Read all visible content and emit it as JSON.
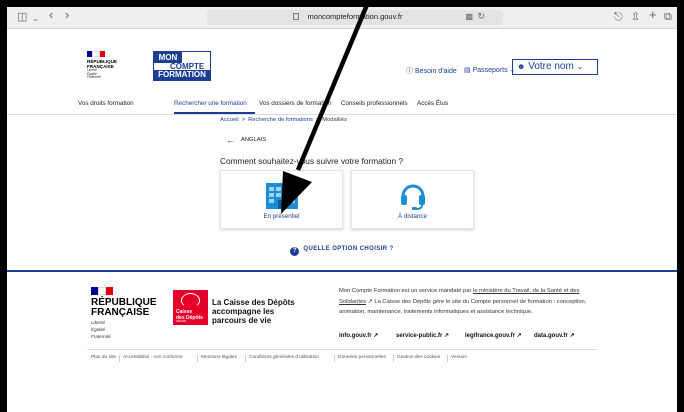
{
  "browser": {
    "url": "moncompteformation.gouv.fr",
    "icons": [
      "sidebar-icon",
      "back-icon",
      "forward-icon",
      "lock-icon",
      "translate-icon",
      "reload-icon",
      "download-icon",
      "share-icon",
      "new-tab-icon",
      "tabs-icon"
    ]
  },
  "header": {
    "republic_line1": "RÉPUBLIQUE",
    "republic_line2": "FRANÇAISE",
    "motto1": "Liberté",
    "motto2": "Égalité",
    "motto3": "Fraternité",
    "logo_line1": "MON",
    "logo_line2": "COMPTE",
    "logo_line3": "FORMATION",
    "help": "Besoin d'aide",
    "passports": "Passeports",
    "user": "Votre nom"
  },
  "nav": {
    "items": [
      "Vos droits formation",
      "Rechercher une formation",
      "Vos dossiers de formation",
      "Conseils professionnels",
      "Accès Élus"
    ],
    "active_index": 1
  },
  "breadcrumb": {
    "home": "Accueil",
    "search": "Recherche de formations",
    "current": "Modalités"
  },
  "selection": {
    "language": "ANGLAIS",
    "question": "Comment souhaitez-vous suivre votre formation ?",
    "options": [
      {
        "label": "En présentiel",
        "icon": "building-icon"
      },
      {
        "label": "À distance",
        "icon": "headset-icon"
      }
    ],
    "help_link": "QUELLE OPTION CHOISIR ?"
  },
  "footer": {
    "republic_line1": "RÉPUBLIQUE",
    "republic_line2": "FRANÇAISE",
    "motto1": "Liberté",
    "motto2": "Égalité",
    "motto3": "Fraternité",
    "cdc_line1": "Caisse",
    "cdc_line2": "des Dépôts",
    "cdc_line3": "GROUPE",
    "cdc_tagline1": "La Caisse des Dépôts",
    "cdc_tagline2": "accompagne les",
    "cdc_tagline3": "parcours de vie",
    "desc_part1": "Mon Compte Formation est un service mandaté par ",
    "desc_link1": "le ministère du Travail, de la Santé et des Solidarités",
    "desc_part2": " La Caisse des Dépôts gère le site du Compte personnel de formation : conception, animation, maintenance, traitements informatiques et assistance technique.",
    "links": [
      "info.gouv.fr",
      "service-public.fr",
      "legifrance.gouv.fr",
      "data.gouv.fr"
    ],
    "bottom_links": [
      "Plan du site",
      "Accessibilité : non conforme",
      "Mentions légales",
      "Conditions générales d'utilisation",
      "Données personnelles",
      "Gestion des cookies",
      "Version"
    ]
  },
  "colors": {
    "primary": "#1c3f94",
    "accent_blue": "#1c8fd4",
    "cdc_red": "#e4002b",
    "flag_blue": "#000091",
    "flag_red": "#e1000f"
  }
}
